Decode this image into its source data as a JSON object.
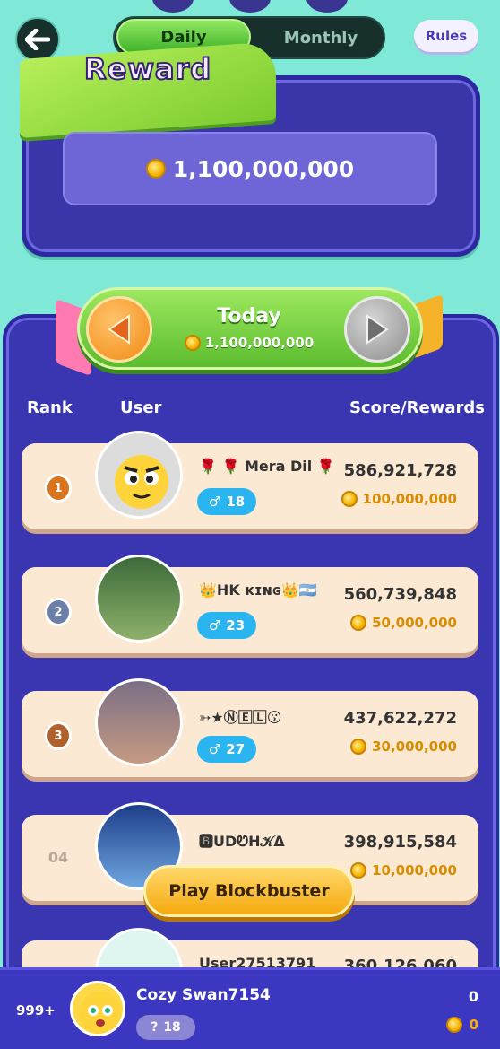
{
  "nav": {
    "back_icon": "arrow-left-icon",
    "rules_label": "Rules"
  },
  "tabs": [
    {
      "label": "Daily",
      "active": true
    },
    {
      "label": "Monthly",
      "active": false
    }
  ],
  "reward": {
    "title": "Reward",
    "amount": "1,100,000,000"
  },
  "period": {
    "title": "Today",
    "amount": "1,100,000,000"
  },
  "columns": {
    "rank": "Rank",
    "user": "User",
    "score": "Score/Rewards"
  },
  "entries": [
    {
      "rank": "1",
      "name": "🌹 🌹 Mera Dil 🌹",
      "level": "18",
      "score": "586,921,728",
      "reward": "100,000,000"
    },
    {
      "rank": "2",
      "name": "👑HK ᴋɪɴɢ👑🇦🇷",
      "level": "23",
      "score": "560,739,848",
      "reward": "50,000,000"
    },
    {
      "rank": "3",
      "name": "➳★Ⓝ🄴🄻😗",
      "level": "27",
      "score": "437,622,272",
      "reward": "30,000,000"
    },
    {
      "rank": "04",
      "name": "🅱UDᏬH𝒦Δ",
      "level": "",
      "score": "398,915,584",
      "reward": "10,000,000"
    },
    {
      "rank": "",
      "name": "User27513791",
      "level": "",
      "score": "360,126,060",
      "reward": ""
    }
  ],
  "play_button": "Play Blockbuster",
  "me": {
    "rank": "999+",
    "name": "Cozy Swan7154",
    "level": "18",
    "score": "0",
    "reward": "0"
  },
  "colors": {
    "background": "#7fe8d6",
    "board": "#3a35b0",
    "row": "#fbe9d4",
    "accent": "#f5a90e"
  }
}
